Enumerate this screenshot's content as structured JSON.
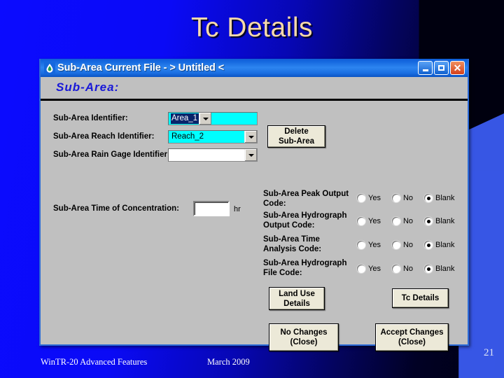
{
  "slide": {
    "title": "Tc Details",
    "page_number": "21",
    "footer_left": "WinTR-20 Advanced Features",
    "footer_center": "March 2009",
    "title_color": "#f7d9ab",
    "background_color": "#0b0bff"
  },
  "dialog": {
    "titlebar": {
      "icon": "water-drop-icon",
      "text": "Sub-Area  Current File - > Untitled <",
      "minimize_label": "Minimize",
      "maximize_label": "Maximize",
      "close_label": "Close"
    },
    "section_heading": "Sub-Area:",
    "fields": [
      {
        "label": "Sub-Area Identifier:",
        "value": "Area_1",
        "selected": true,
        "background": "#00ffff"
      },
      {
        "label": "Sub-Area Reach Identifier:",
        "value": "Reach_2",
        "selected": false,
        "background": "#00ffff"
      },
      {
        "label": "Sub-Area Rain Gage Identifier:",
        "value": "",
        "selected": false,
        "background": "#ffffff"
      }
    ],
    "tc_field": {
      "label": "Sub-Area Time of Concentration:",
      "value": "",
      "unit": "hr"
    },
    "delete_button": "Delete\nSub-Area",
    "delete_button_l1": "Delete",
    "delete_button_l2": "Sub-Area",
    "radio_groups": [
      {
        "label": "Sub-Area Peak Output\nCode:",
        "label_l1": "Sub-Area Peak Output",
        "label_l2": "Code:",
        "options": [
          "Yes",
          "No",
          "Blank"
        ],
        "selected": "Blank"
      },
      {
        "label": "Sub-Area Hydrograph\nOutput Code:",
        "label_l1": "Sub-Area Hydrograph",
        "label_l2": "Output Code:",
        "options": [
          "Yes",
          "No",
          "Blank"
        ],
        "selected": "Blank"
      },
      {
        "label": "Sub-Area Time\nAnalysis Code:",
        "label_l1": "Sub-Area Time",
        "label_l2": "Analysis Code:",
        "options": [
          "Yes",
          "No",
          "Blank"
        ],
        "selected": "Blank"
      },
      {
        "label": "Sub-Area Hydrograph\nFile Code:",
        "label_l1": "Sub-Area Hydrograph",
        "label_l2": "File Code:",
        "options": [
          "Yes",
          "No",
          "Blank"
        ],
        "selected": "Blank"
      }
    ],
    "buttons": {
      "land_use_l1": "Land Use",
      "land_use_l2": "Details",
      "tc_details": "Tc Details",
      "no_changes_l1": "No Changes",
      "no_changes_l2": "(Close)",
      "accept_changes_l1": "Accept Changes",
      "accept_changes_l2": "(Close)"
    }
  }
}
